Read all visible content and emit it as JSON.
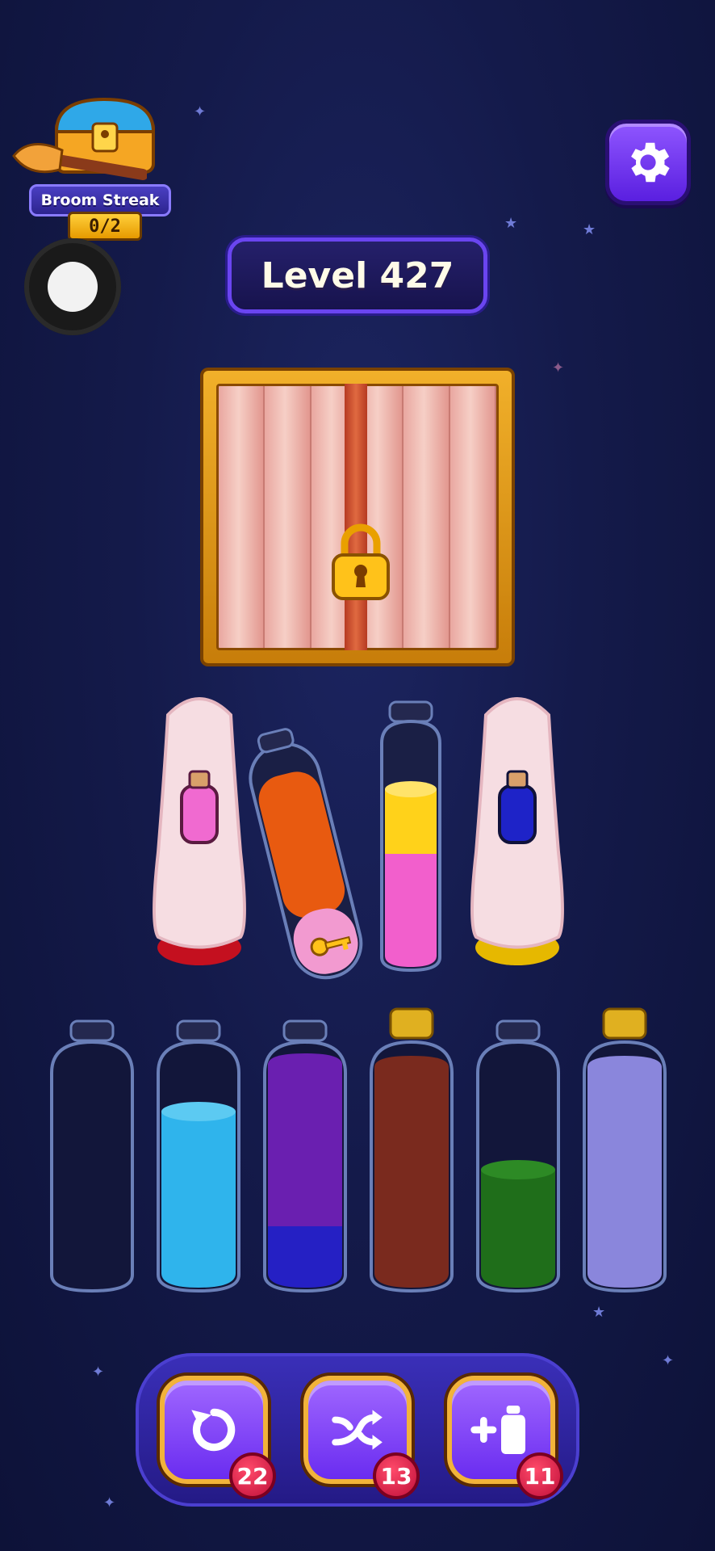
{
  "streak": {
    "title": "Broom Streak",
    "progress": "0/2"
  },
  "level": {
    "label": "Level 427"
  },
  "crate": {
    "icon": "padlock-icon",
    "locked": true
  },
  "colors": {
    "background": "#141a4a",
    "accent_purple": "#6a2cf0",
    "gold": "#f2b33a"
  },
  "top_row": [
    {
      "state": "covered",
      "hint_color": "#f06ad0",
      "base_color": "#c4101f"
    },
    {
      "state": "selected",
      "layers": [
        "#f07a10",
        "#e04a10",
        "#f29ad0"
      ],
      "has_key": true
    },
    {
      "state": "open",
      "layers": [
        "#ffd21a",
        "#f25fcc",
        "#f25fcc"
      ],
      "capped": false
    },
    {
      "state": "covered",
      "hint_color": "#1e23c8",
      "base_color": "#e6b800"
    }
  ],
  "bottom_row": [
    {
      "fill": 0,
      "color": "#000000",
      "capped": false
    },
    {
      "fill": 0.72,
      "color": "#2fb4ec",
      "capped": false
    },
    {
      "fill": 0.92,
      "color": "#6a1fb0",
      "bottom_color": "#2520c4",
      "capped": false
    },
    {
      "fill": 0.95,
      "color": "#7a2a1e",
      "capped": true
    },
    {
      "fill": 0.45,
      "color": "#1f6e1a",
      "capped": false
    },
    {
      "fill": 0.95,
      "color": "#8a86dc",
      "capped": true
    }
  ],
  "tools": [
    {
      "name": "undo",
      "icon": "undo-icon",
      "count": "22"
    },
    {
      "name": "shuffle",
      "icon": "shuffle-icon",
      "count": "13"
    },
    {
      "name": "add-tube",
      "icon": "add-tube-icon",
      "count": "11"
    }
  ]
}
